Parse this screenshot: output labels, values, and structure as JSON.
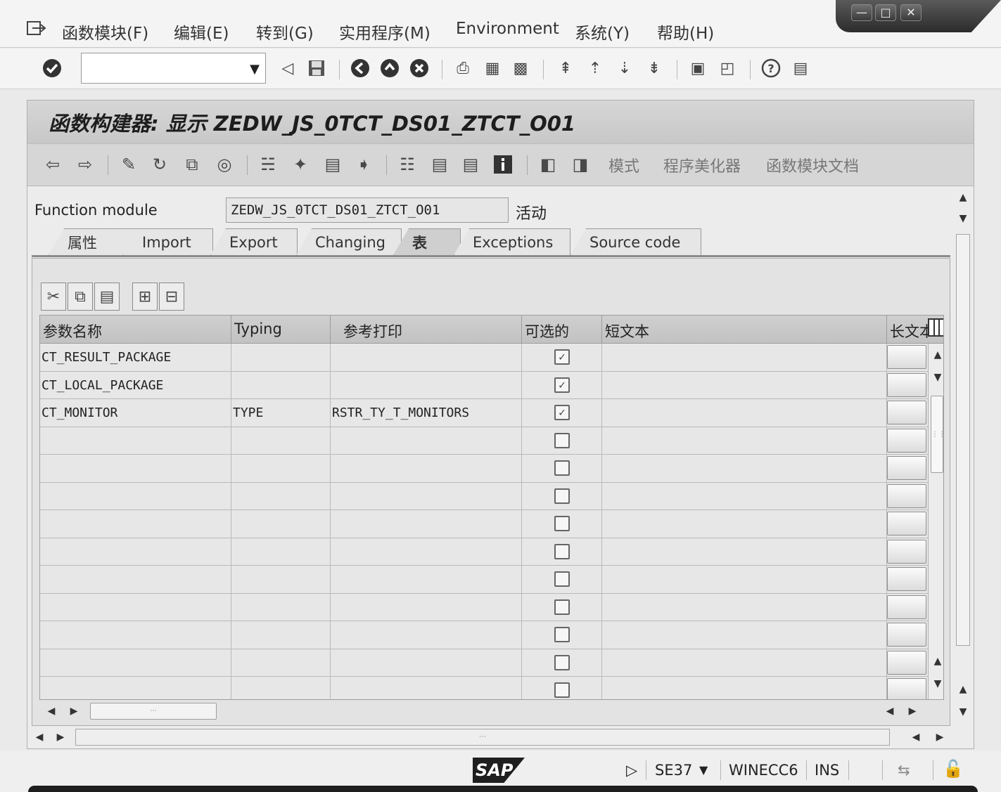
{
  "menubar": {
    "items": [
      "函数模块(F)",
      "编辑(E)",
      "转到(G)",
      "实用程序(M)",
      "Environment",
      "系统(Y)",
      "帮助(H)"
    ],
    "window_controls": [
      "minimize",
      "maximize",
      "close"
    ]
  },
  "systoolbar": {
    "command_value": "",
    "icons": [
      "enter-icon",
      "back-icon",
      "save-icon",
      "back-nav-icon",
      "exit-icon",
      "cancel-icon",
      "print-icon",
      "find-icon",
      "find-next-icon",
      "first-page-icon",
      "prev-page-icon",
      "next-page-icon",
      "last-page-icon",
      "new-session-icon",
      "shortcut-icon",
      "help-icon",
      "layout-icon"
    ]
  },
  "title": {
    "text": "函数构建器: 显示 ZEDW_JS_0TCT_DS01_ZTCT_O01"
  },
  "app_toolbar": {
    "text_buttons": [
      "模式",
      "程序美化器",
      "函数模块文档"
    ]
  },
  "function_module": {
    "label": "Function module",
    "value": "ZEDW_JS_0TCT_DS01_ZTCT_O01",
    "status": "活动"
  },
  "tabs": [
    {
      "label": "属性",
      "active": false
    },
    {
      "label": "Import",
      "active": false
    },
    {
      "label": "Export",
      "active": false
    },
    {
      "label": "Changing",
      "active": false
    },
    {
      "label": "表",
      "active": true
    },
    {
      "label": "Exceptions",
      "active": false
    },
    {
      "label": "Source code",
      "active": false
    }
  ],
  "table": {
    "columns": [
      "参数名称",
      "Typing",
      "参考打印",
      "可选的",
      "短文本",
      "长文本"
    ],
    "rows": [
      {
        "name": "CT_RESULT_PACKAGE",
        "typing": "",
        "ref": "",
        "optional": true,
        "short": ""
      },
      {
        "name": "CT_LOCAL_PACKAGE",
        "typing": "",
        "ref": "",
        "optional": true,
        "short": ""
      },
      {
        "name": "CT_MONITOR",
        "typing": "TYPE",
        "ref": "RSTR_TY_T_MONITORS",
        "optional": true,
        "short": ""
      },
      {
        "name": "",
        "typing": "",
        "ref": "",
        "optional": false,
        "short": ""
      },
      {
        "name": "",
        "typing": "",
        "ref": "",
        "optional": false,
        "short": ""
      },
      {
        "name": "",
        "typing": "",
        "ref": "",
        "optional": false,
        "short": ""
      },
      {
        "name": "",
        "typing": "",
        "ref": "",
        "optional": false,
        "short": ""
      },
      {
        "name": "",
        "typing": "",
        "ref": "",
        "optional": false,
        "short": ""
      },
      {
        "name": "",
        "typing": "",
        "ref": "",
        "optional": false,
        "short": ""
      },
      {
        "name": "",
        "typing": "",
        "ref": "",
        "optional": false,
        "short": ""
      },
      {
        "name": "",
        "typing": "",
        "ref": "",
        "optional": false,
        "short": ""
      },
      {
        "name": "",
        "typing": "",
        "ref": "",
        "optional": false,
        "short": ""
      },
      {
        "name": "",
        "typing": "",
        "ref": "",
        "optional": false,
        "short": ""
      }
    ]
  },
  "statusbar": {
    "logo": "SAP",
    "transaction": "SE37",
    "system": "WINECC6",
    "mode": "INS"
  }
}
